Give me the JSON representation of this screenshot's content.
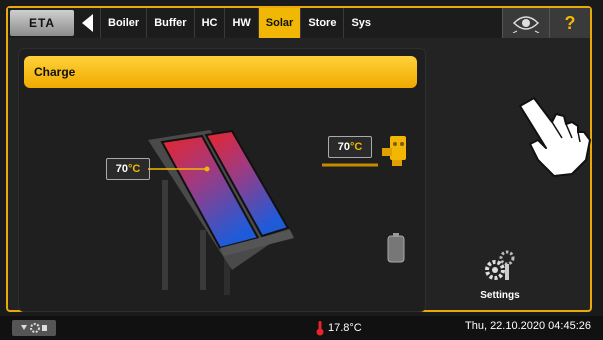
{
  "header": {
    "logo": "ETA",
    "tabs": [
      "Boiler",
      "Buffer",
      "HC",
      "HW",
      "Solar",
      "Store",
      "Sys"
    ],
    "active_tab": "Solar",
    "help_label": "?"
  },
  "main": {
    "status_label": "Charge",
    "collector_temp": {
      "value": "70",
      "unit": "°C"
    },
    "buffer_temp": {
      "value": "70",
      "unit": "°C"
    }
  },
  "sidebar": {
    "settings_label": "Settings"
  },
  "statusbar": {
    "outdoor_temp": "17.8°C",
    "datetime": "Thu, 22.10.2020 04:45:26"
  },
  "colors": {
    "accent": "#f2b705",
    "hot": "#e8252b",
    "cold": "#1f5bd8"
  }
}
